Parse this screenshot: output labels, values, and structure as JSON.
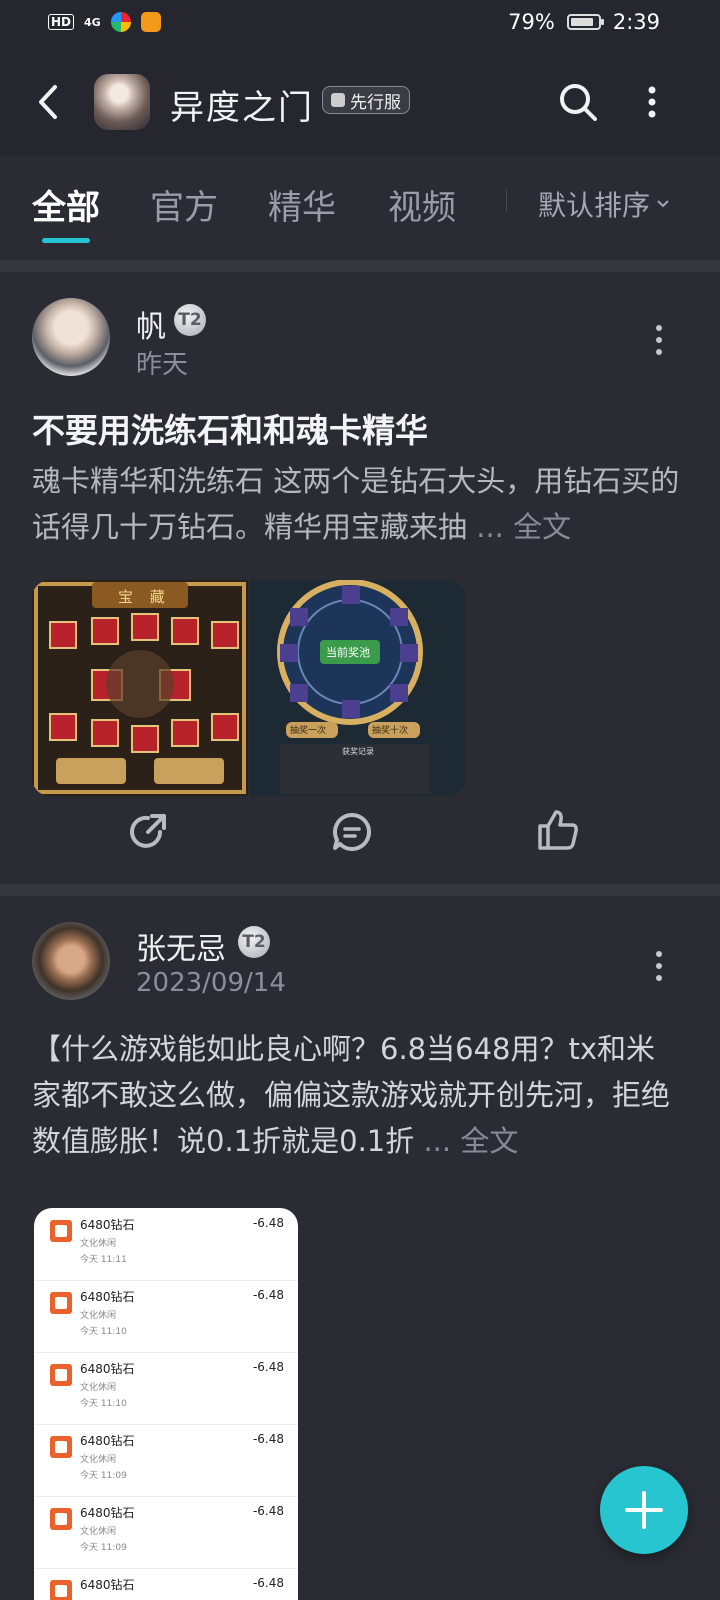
{
  "status_bar": {
    "network": "HD",
    "signal": "4G",
    "battery": "79%",
    "time": "2:39"
  },
  "header": {
    "title": "异度之门",
    "badge": "先行服"
  },
  "tabs": [
    {
      "label": "全部",
      "active": true
    },
    {
      "label": "官方",
      "active": false
    },
    {
      "label": "精华",
      "active": false
    },
    {
      "label": "视频",
      "active": false
    }
  ],
  "sort": {
    "label": "默认排序"
  },
  "posts": [
    {
      "user": "帆",
      "level": "T2",
      "time": "昨天",
      "title": "不要用洗练石和和魂卡精华",
      "body": "魂卡精华和洗练石 这两个是钻石大头，用钻石买的话得几十万钻石。精华用宝藏来抽",
      "more": "... 全文"
    },
    {
      "user": "张无忌",
      "level": "T2",
      "time": "2023/09/14",
      "title": "",
      "body": "【什么游戏能如此良心啊？6.8当648用？tx和米家都不敢这么做，偏偏这款游戏就开创先河，拒绝数值膨胀！说0.1折就是0.1折",
      "more": "... 全文"
    }
  ],
  "screenshot1": {
    "left_title": "宝 藏",
    "right_center": "当前奖池",
    "btn_one": "抽奖一次",
    "btn_ten": "抽奖十次",
    "record": "获奖记录"
  },
  "receipt": {
    "rows": [
      {
        "name": "6480钻石",
        "category": "文化休闲",
        "time": "今天 11:11",
        "amount": "-6.48"
      },
      {
        "name": "6480钻石",
        "category": "文化休闲",
        "time": "今天 11:10",
        "amount": "-6.48"
      },
      {
        "name": "6480钻石",
        "category": "文化休闲",
        "time": "今天 11:10",
        "amount": "-6.48"
      },
      {
        "name": "6480钻石",
        "category": "文化休闲",
        "time": "今天 11:09",
        "amount": "-6.48"
      },
      {
        "name": "6480钻石",
        "category": "文化休闲",
        "time": "今天 11:09",
        "amount": "-6.48"
      },
      {
        "name": "6480钻石",
        "category": "",
        "time": "",
        "amount": "-6.48"
      }
    ]
  },
  "colors": {
    "background": "#26272e",
    "card": "#2a2b33",
    "accent": "#26c3d0"
  },
  "icons": {
    "back": "back-arrow-icon",
    "search": "search-icon",
    "more": "more-vertical-icon",
    "share": "share-icon",
    "comment": "comment-icon",
    "like": "thumb-up-icon",
    "add": "plus-icon"
  }
}
